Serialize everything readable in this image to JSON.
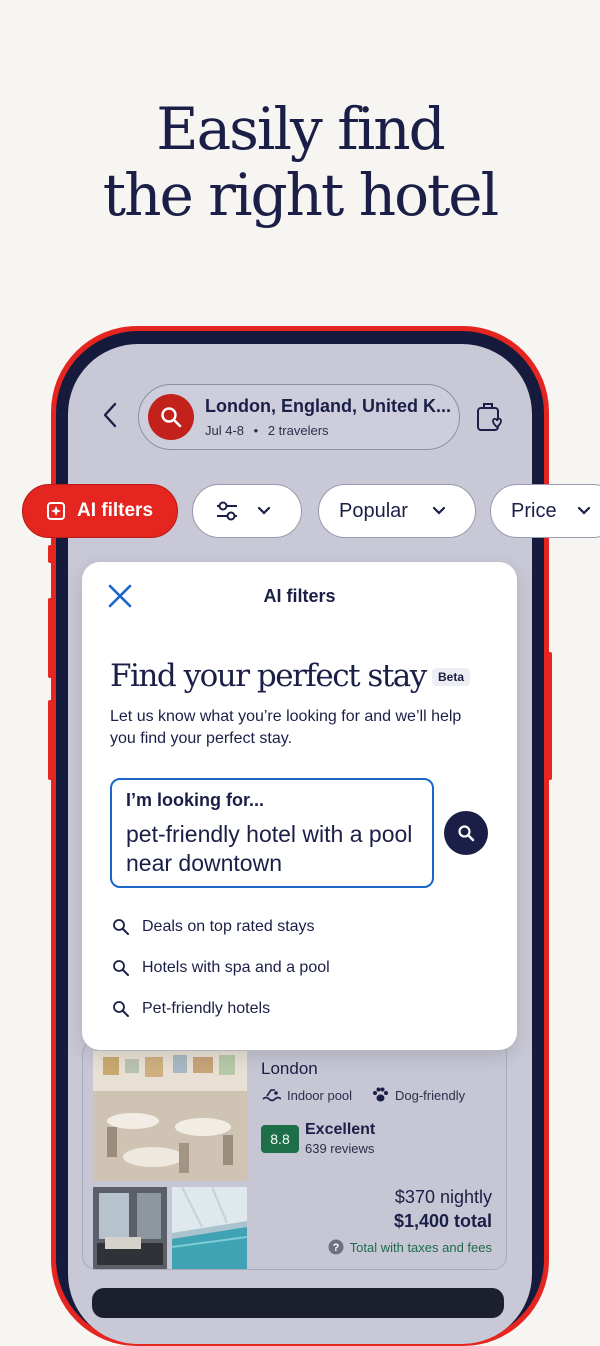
{
  "headline": {
    "line1": "Easily find",
    "line2": "the right hotel"
  },
  "search": {
    "location": "London, England, United K...",
    "dates": "Jul 4-8",
    "separator": "•",
    "travelers": "2 travelers"
  },
  "filters": {
    "ai_label": "AI filters",
    "sort_label": "Popular",
    "price_label": "Price"
  },
  "modal": {
    "title": "AI filters",
    "heading": "Find your perfect stay",
    "badge": "Beta",
    "description": "Let us know what you’re looking for and we’ll help you find your perfect stay.",
    "query_label": "I’m looking for...",
    "query_value": "pet-friendly hotel with a pool near downtown",
    "suggestions": [
      "Deals on top rated stays",
      "Hotels with spa and a pool",
      "Pet-friendly hotels"
    ]
  },
  "hotel": {
    "city": "London",
    "amenities": [
      "Indoor pool",
      "Dog-friendly"
    ],
    "rating": "8.8",
    "rating_word": "Excellent",
    "reviews": "639 reviews",
    "price_nightly": "$370 nightly",
    "price_total": "$1,400 total",
    "price_note": "Total with taxes and fees"
  },
  "colors": {
    "brand_red": "#e52620",
    "navy": "#1b1f47",
    "accent_blue": "#1a66c9",
    "rating_green": "#1f6e4a"
  }
}
